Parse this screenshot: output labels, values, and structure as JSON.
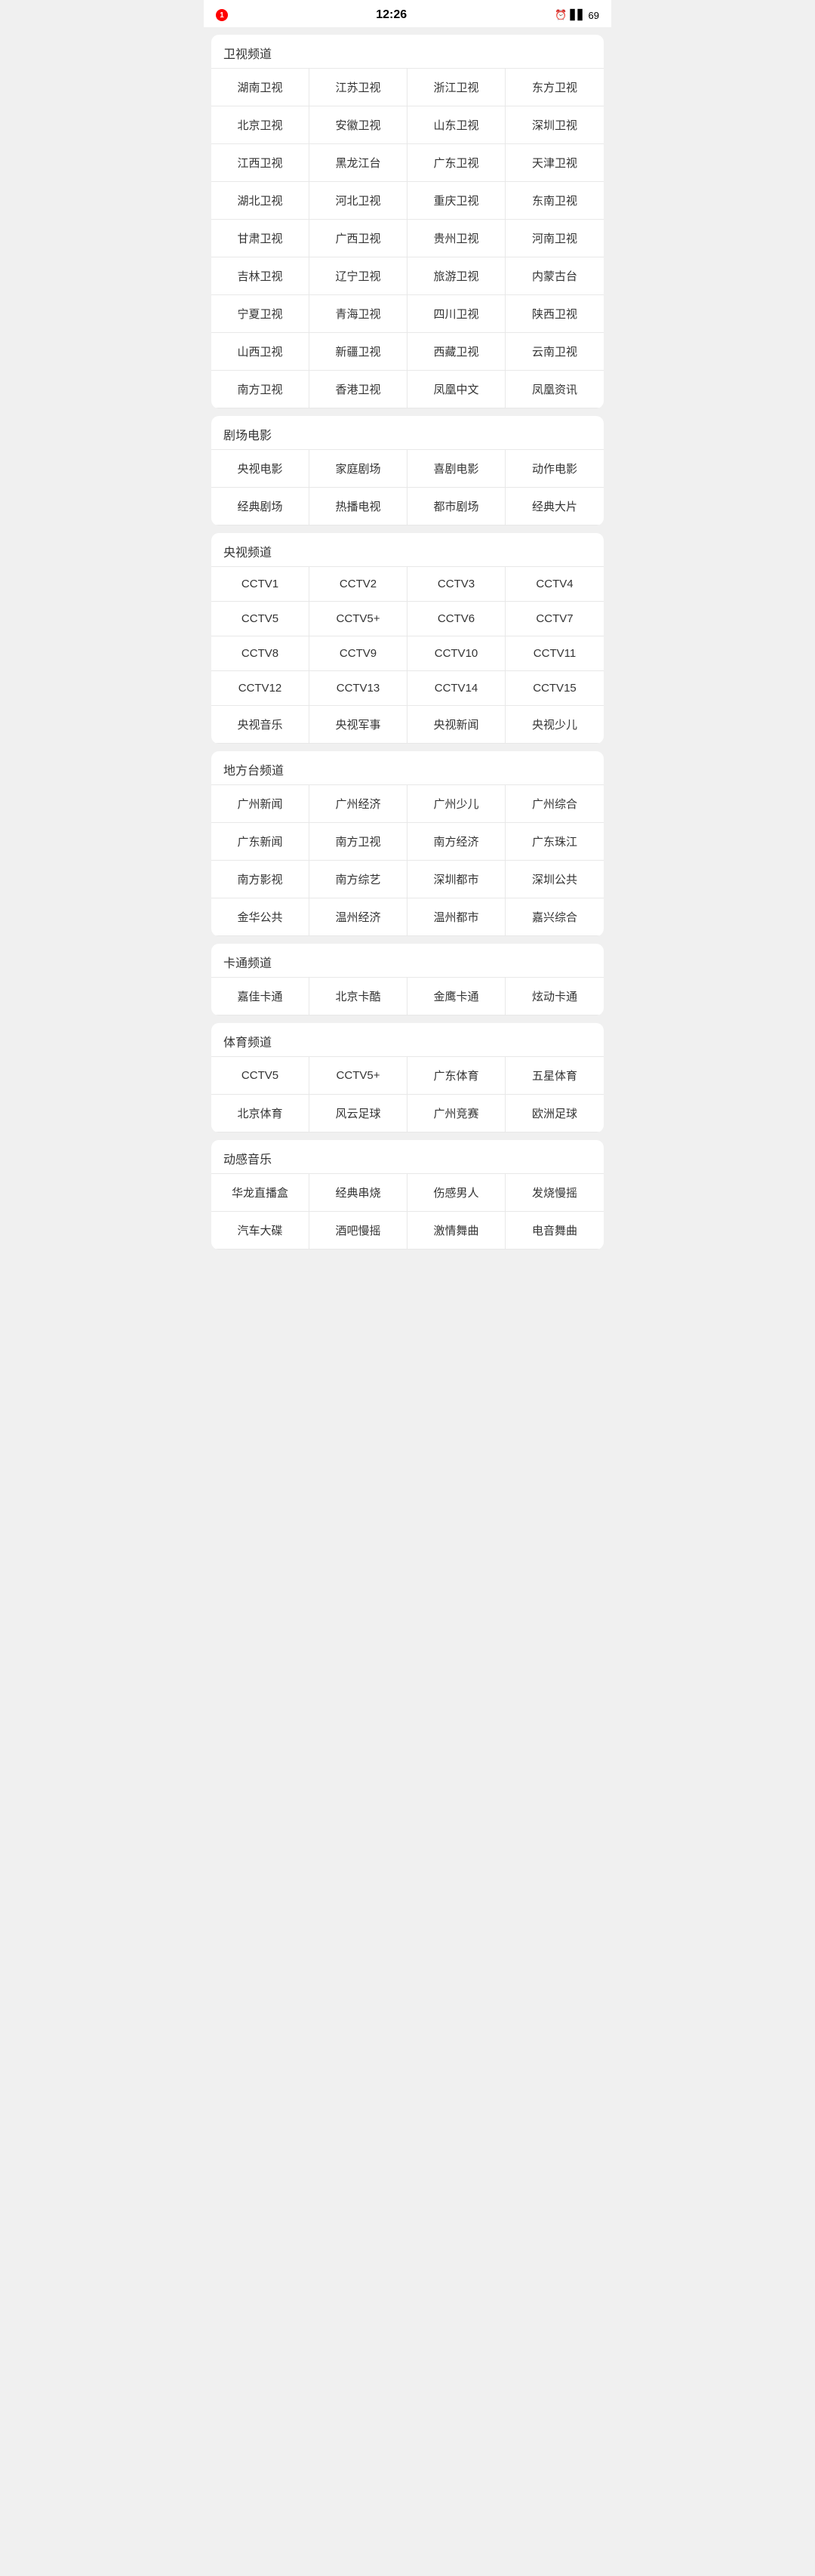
{
  "statusBar": {
    "time": "12:26",
    "notification": "1",
    "battery": "69"
  },
  "sections": [
    {
      "id": "satellite",
      "title": "卫视频道",
      "channels": [
        "湖南卫视",
        "江苏卫视",
        "浙江卫视",
        "东方卫视",
        "北京卫视",
        "安徽卫视",
        "山东卫视",
        "深圳卫视",
        "江西卫视",
        "黑龙江台",
        "广东卫视",
        "天津卫视",
        "湖北卫视",
        "河北卫视",
        "重庆卫视",
        "东南卫视",
        "甘肃卫视",
        "广西卫视",
        "贵州卫视",
        "河南卫视",
        "吉林卫视",
        "辽宁卫视",
        "旅游卫视",
        "内蒙古台",
        "宁夏卫视",
        "青海卫视",
        "四川卫视",
        "陕西卫视",
        "山西卫视",
        "新疆卫视",
        "西藏卫视",
        "云南卫视",
        "南方卫视",
        "香港卫视",
        "凤凰中文",
        "凤凰资讯"
      ]
    },
    {
      "id": "drama-movie",
      "title": "剧场电影",
      "channels": [
        "央视电影",
        "家庭剧场",
        "喜剧电影",
        "动作电影",
        "经典剧场",
        "热播电视",
        "都市剧场",
        "经典大片"
      ]
    },
    {
      "id": "cctv",
      "title": "央视频道",
      "channels": [
        "CCTV1",
        "CCTV2",
        "CCTV3",
        "CCTV4",
        "CCTV5",
        "CCTV5+",
        "CCTV6",
        "CCTV7",
        "CCTV8",
        "CCTV9",
        "CCTV10",
        "CCTV11",
        "CCTV12",
        "CCTV13",
        "CCTV14",
        "CCTV15",
        "央视音乐",
        "央视军事",
        "央视新闻",
        "央视少儿"
      ]
    },
    {
      "id": "local",
      "title": "地方台频道",
      "channels": [
        "广州新闻",
        "广州经济",
        "广州少儿",
        "广州综合",
        "广东新闻",
        "南方卫视",
        "南方经济",
        "广东珠江",
        "南方影视",
        "南方综艺",
        "深圳都市",
        "深圳公共",
        "金华公共",
        "温州经济",
        "温州都市",
        "嘉兴综合"
      ]
    },
    {
      "id": "cartoon",
      "title": "卡通频道",
      "channels": [
        "嘉佳卡通",
        "北京卡酷",
        "金鹰卡通",
        "炫动卡通"
      ]
    },
    {
      "id": "sports",
      "title": "体育频道",
      "channels": [
        "CCTV5",
        "CCTV5+",
        "广东体育",
        "五星体育",
        "北京体育",
        "风云足球",
        "广州竞赛",
        "欧洲足球"
      ]
    },
    {
      "id": "music",
      "title": "动感音乐",
      "channels": [
        "华龙直播盒",
        "经典串烧",
        "伤感男人",
        "发烧慢摇",
        "汽车大碟",
        "酒吧慢摇",
        "激情舞曲",
        "电音舞曲"
      ]
    }
  ]
}
